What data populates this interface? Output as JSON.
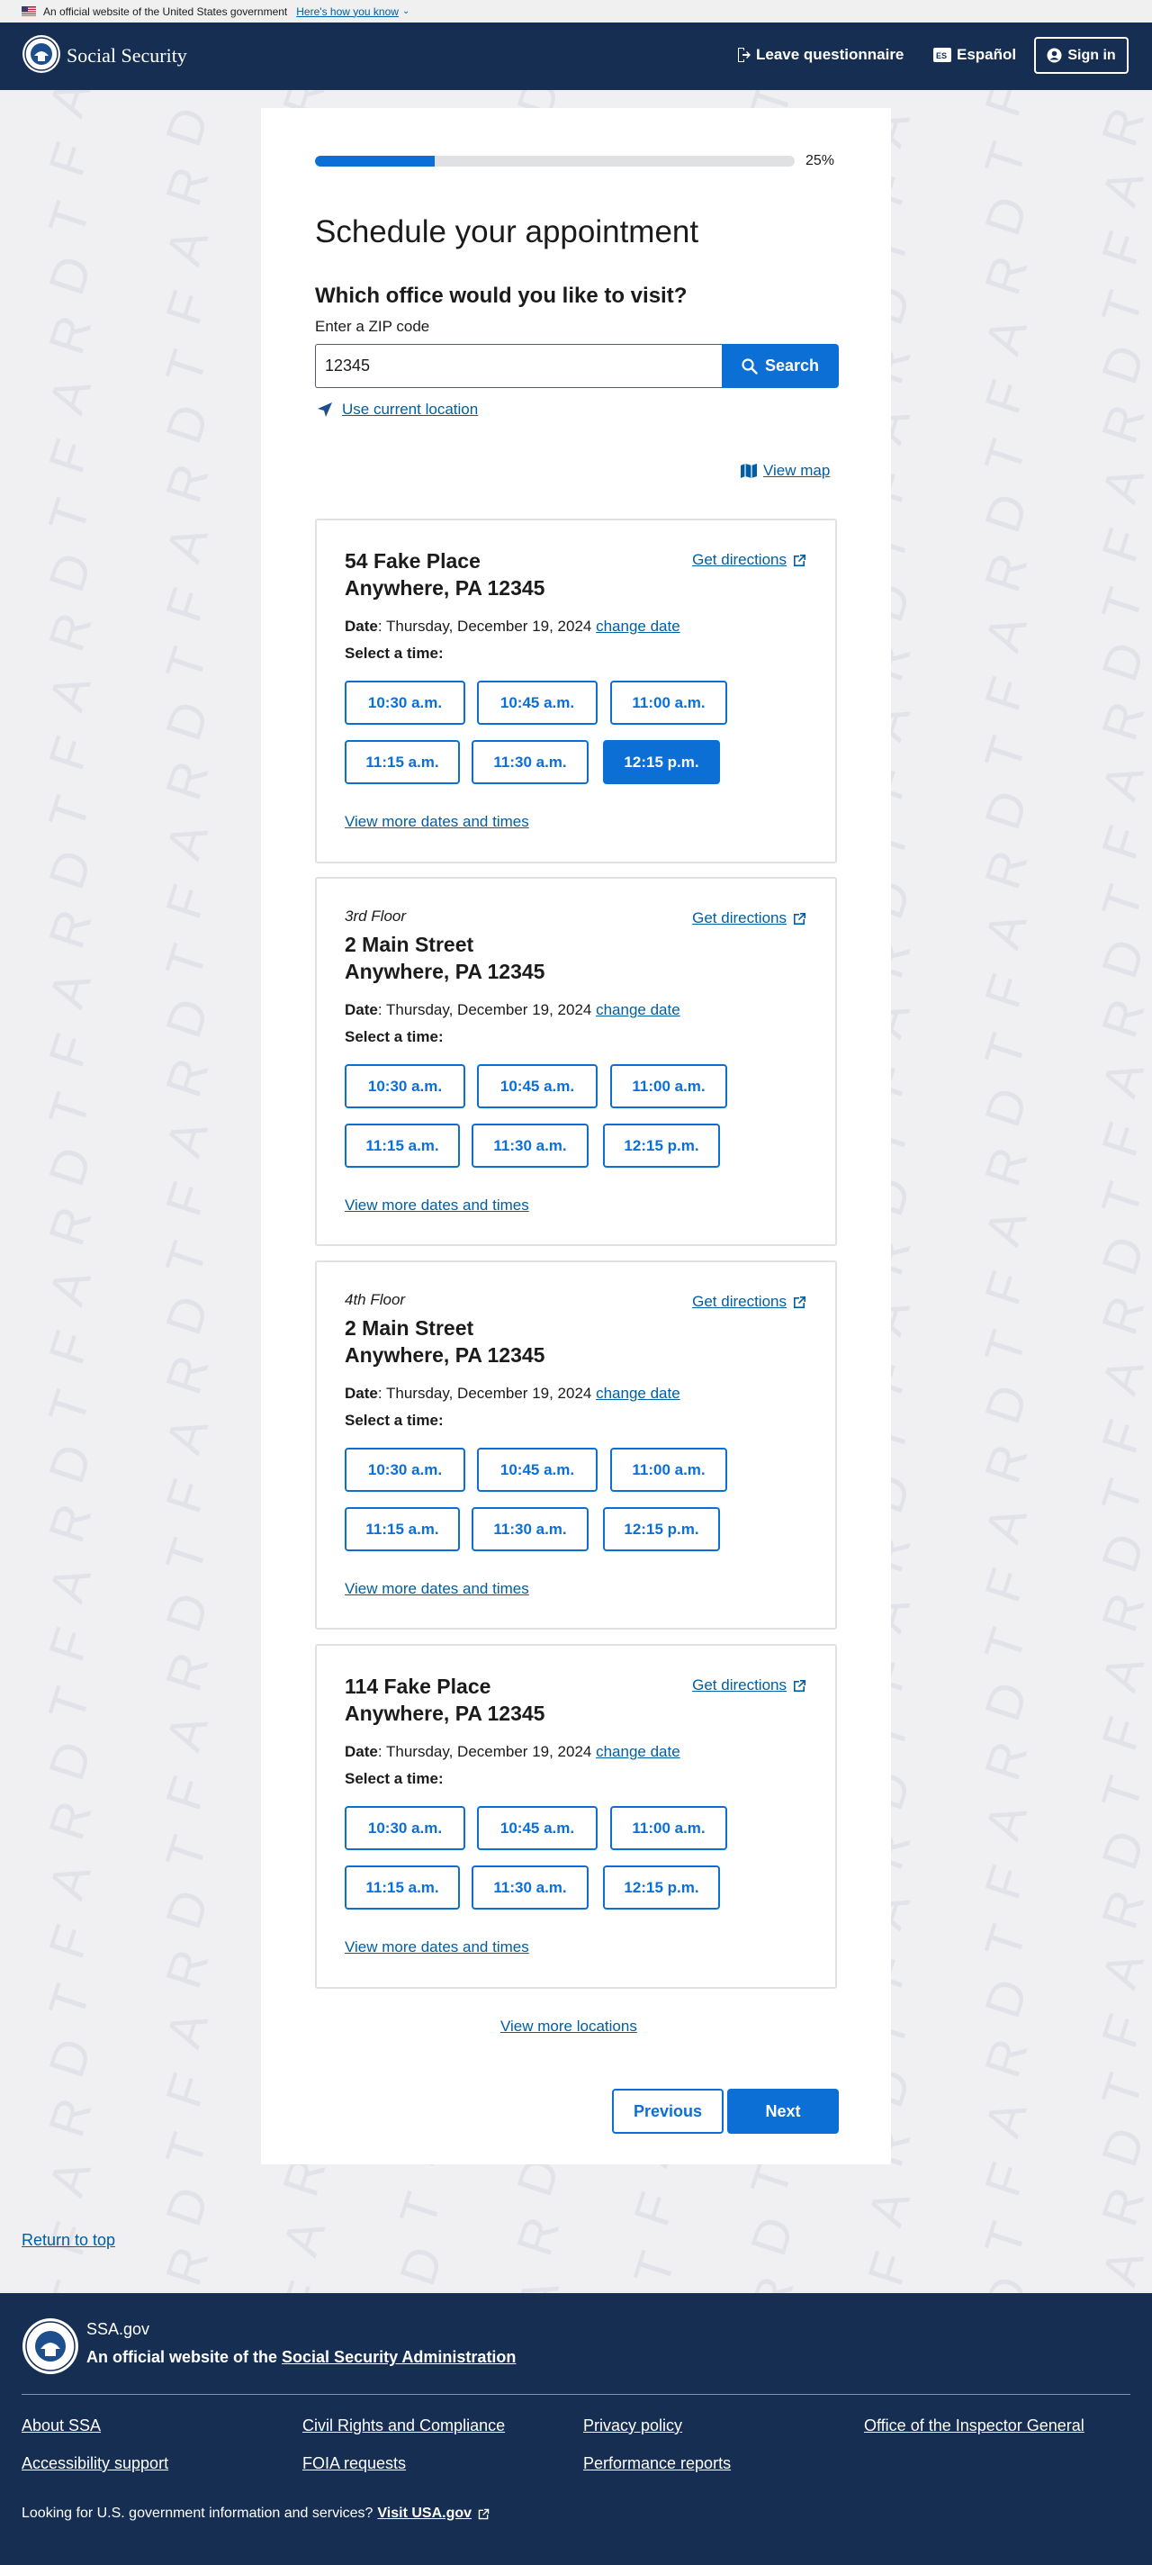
{
  "banner": {
    "text": "An official website of the United States government",
    "link": "Here's how you know"
  },
  "header": {
    "site_name": "Social Security",
    "leave_label": "Leave questionnaire",
    "espanol_label": "Español",
    "signin_label": "Sign in"
  },
  "progress": {
    "percent": 25,
    "label": "25%"
  },
  "page": {
    "title": "Schedule your appointment",
    "question": "Which office would you like to visit?",
    "zip_label": "Enter a ZIP code",
    "zip_value": "12345",
    "search_label": "Search",
    "use_location": "Use current location",
    "view_map": "View map",
    "view_more_locations": "View more locations",
    "previous": "Previous",
    "next": "Next"
  },
  "locations": [
    {
      "floor": "",
      "address1": "54 Fake Place",
      "address2": "Anywhere, PA 12345",
      "directions": "Get directions",
      "date_label": "Date",
      "date_value": ": Thursday, December 19, 2024 ",
      "change_date": "change date",
      "select_time": "Select a time:",
      "times": [
        "10:30 a.m.",
        "10:45 a.m.",
        "11:00 a.m.",
        "11:15 a.m.",
        "11:30 a.m.",
        "12:15 p.m."
      ],
      "selected_time": "12:15 p.m.",
      "more_times": "View more dates and times"
    },
    {
      "floor": "3rd Floor",
      "address1": "2 Main Street",
      "address2": "Anywhere, PA 12345",
      "directions": "Get directions",
      "date_label": "Date",
      "date_value": ": Thursday, December 19, 2024 ",
      "change_date": "change date",
      "select_time": "Select a time:",
      "times": [
        "10:30 a.m.",
        "10:45 a.m.",
        "11:00 a.m.",
        "11:15 a.m.",
        "11:30 a.m.",
        "12:15 p.m."
      ],
      "selected_time": "",
      "more_times": "View more dates and times"
    },
    {
      "floor": "4th Floor",
      "address1": "2 Main Street",
      "address2": "Anywhere, PA 12345",
      "directions": "Get directions",
      "date_label": "Date",
      "date_value": ": Thursday, December 19, 2024 ",
      "change_date": "change date",
      "select_time": "Select a time:",
      "times": [
        "10:30 a.m.",
        "10:45 a.m.",
        "11:00 a.m.",
        "11:15 a.m.",
        "11:30 a.m.",
        "12:15 p.m."
      ],
      "selected_time": "",
      "more_times": "View more dates and times"
    },
    {
      "floor": "",
      "address1": "114 Fake Place",
      "address2": "Anywhere, PA 12345",
      "directions": "Get directions",
      "date_label": "Date",
      "date_value": ": Thursday, December 19, 2024 ",
      "change_date": "change date",
      "select_time": "Select a time:",
      "times": [
        "10:30 a.m.",
        "10:45 a.m.",
        "11:00 a.m.",
        "11:15 a.m.",
        "11:30 a.m.",
        "12:15 p.m."
      ],
      "selected_time": "",
      "more_times": "View more dates and times"
    }
  ],
  "return_to_top": "Return to top",
  "footer": {
    "site": "SSA.gov",
    "official_prefix": "An official website of the ",
    "official_link": "Social Security Administration",
    "links": [
      "About SSA",
      "Civil Rights and Compliance",
      "Privacy policy",
      "Office of the Inspector General",
      "Accessibility support",
      "FOIA requests",
      "Performance reports"
    ],
    "usa_text": "Looking for U.S. government information and services?",
    "usa_link": "Visit USA.gov"
  },
  "watermark": "DRAFT",
  "colors": {
    "primary": "#0b6fd6",
    "navy": "#162e51",
    "link": "#005ea2",
    "background": "#f0f0f3"
  }
}
